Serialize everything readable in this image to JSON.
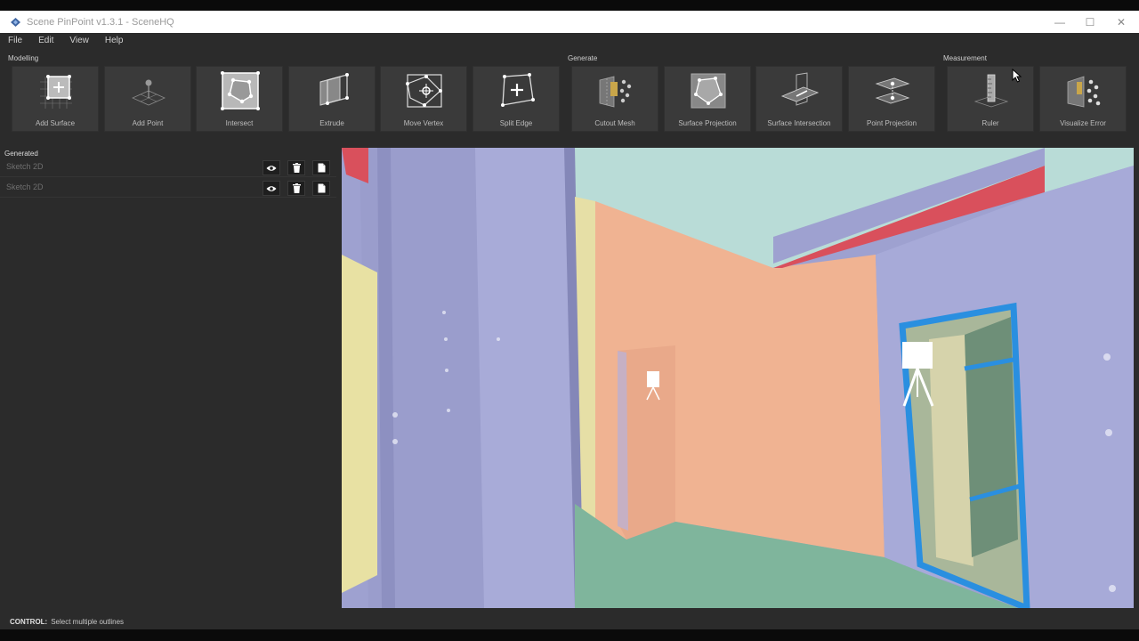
{
  "window": {
    "title": "Scene PinPoint v1.3.1 - SceneHQ",
    "controls": [
      "—",
      "☐",
      "✕"
    ]
  },
  "menu": [
    "File",
    "Edit",
    "View",
    "Help"
  ],
  "groups": {
    "modelling": "Modelling",
    "generate": "Generate",
    "measurement": "Measurement"
  },
  "tools": [
    {
      "label": "Add Surface",
      "icon": "add-surface-icon"
    },
    {
      "label": "Add Point",
      "icon": "add-point-icon"
    },
    {
      "label": "Intersect",
      "icon": "intersect-icon"
    },
    {
      "label": "Extrude",
      "icon": "extrude-icon"
    },
    {
      "label": "Move Vertex",
      "icon": "move-vertex-icon"
    },
    {
      "label": "Split Edge",
      "icon": "split-edge-icon"
    },
    {
      "label": "Cutout Mesh",
      "icon": "cutout-mesh-icon"
    },
    {
      "label": "Surface Projection",
      "icon": "surface-projection-icon"
    },
    {
      "label": "Surface Intersection",
      "icon": "surface-intersection-icon"
    },
    {
      "label": "Point Projection",
      "icon": "point-projection-icon"
    },
    {
      "label": "Ruler",
      "icon": "ruler-icon"
    },
    {
      "label": "Visualize Error",
      "icon": "visualize-error-icon"
    }
  ],
  "panel": {
    "title": "Generated",
    "items": [
      {
        "name": "Sketch 2D"
      },
      {
        "name": "Sketch 2D"
      }
    ]
  },
  "status": {
    "key": "CONTROL:",
    "text": "Select multiple outlines"
  },
  "colors": {
    "app_bg": "#2b2b2b",
    "tool_bg": "#3a3a3a",
    "titlebar_bg": "#ffffff",
    "wall_lavender": "#9ea1d0",
    "wall_salmon": "#f0b392",
    "floor_teal": "#7fb59c",
    "ceiling_red": "#d9505c",
    "frame_blue": "#2a8fe0"
  }
}
